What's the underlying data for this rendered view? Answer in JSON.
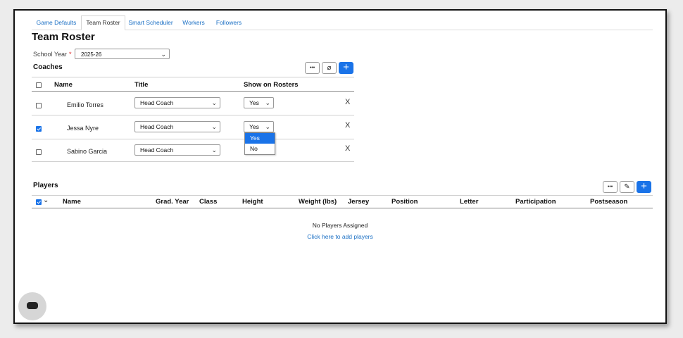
{
  "tabs": [
    "Game Defaults",
    "Team Roster",
    "Smart Scheduler",
    "Workers",
    "Followers"
  ],
  "active_tab": "Team Roster",
  "page_title": "Team Roster",
  "school_year": {
    "label": "School Year",
    "required_mark": "*",
    "value": "2025-26"
  },
  "coaches": {
    "title": "Coaches",
    "buttons": {
      "more": "•••",
      "unlink": "⌀",
      "add": "+"
    },
    "columns": {
      "name": "Name",
      "title": "Title",
      "show": "Show on Rosters"
    },
    "rows": [
      {
        "name": "Emilio Torres",
        "title": "Head Coach",
        "show": "Yes",
        "checked": false,
        "remove": "X"
      },
      {
        "name": "Jessa Nyre",
        "title": "Head Coach",
        "show": "Yes",
        "checked": true,
        "remove": "X"
      },
      {
        "name": "Sabino Garcia",
        "title": "Head Coach",
        "show": "",
        "checked": false,
        "remove": "X"
      }
    ],
    "dropdown_options": [
      "Yes",
      "No"
    ],
    "dropdown_highlighted": "Yes"
  },
  "players": {
    "title": "Players",
    "buttons": {
      "more": "•••",
      "edit": "✎",
      "add": "+"
    },
    "columns": [
      "Name",
      "Grad. Year",
      "Class",
      "Height",
      "Weight (lbs)",
      "Jersey",
      "Position",
      "Letter",
      "Participation",
      "Postseason"
    ],
    "empty_message": "No Players Assigned",
    "add_link": "Click here to add players"
  },
  "icons": {
    "chevron": "chevron-down-icon",
    "chat": "chat-bubble-icon"
  }
}
